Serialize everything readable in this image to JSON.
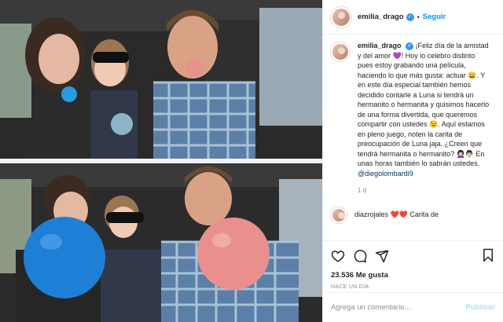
{
  "post": {
    "username": "emilia_drago",
    "follow_label": "Seguir",
    "caption_parts": [
      "¡Feliz día de la amistad y del amor 💜! Hoy lo celebro distinto pues estoy grabando una película, haciendo lo que más gusta: actuar 😀. Y en este día especial también hemos decidido contarle a Luna si tendrá un hermanito o hermanita y quisimos hacerlo de una forma divertida, que queremos compartir con ustedes 😉. Aquí estamos en pleno juego, noten la carita de preocupación de Luna jaja. ¿Creen que tendrá hermanita o hermanito? 👩🏻‍🦱👨🏻 En unas horas también lo sabrán ustedes. "
    ],
    "mention": "@diegolombardi9",
    "caption_time": "1 d",
    "comment_preview": "diazrojales ❤️❤️ Carita de",
    "likes": "23.536 Me gusta",
    "time_ago": "HACE UN DÍA",
    "comment_placeholder": "Agrega un comentario...",
    "publish_label": "Publicar"
  },
  "icons": [
    "heart-icon",
    "comment-icon",
    "share-icon",
    "bookmark-icon",
    "verified-icon"
  ],
  "colors": {
    "accent": "#0095f6",
    "verified": "#3897f0",
    "text": "#262626",
    "muted": "#8e8e8e"
  }
}
